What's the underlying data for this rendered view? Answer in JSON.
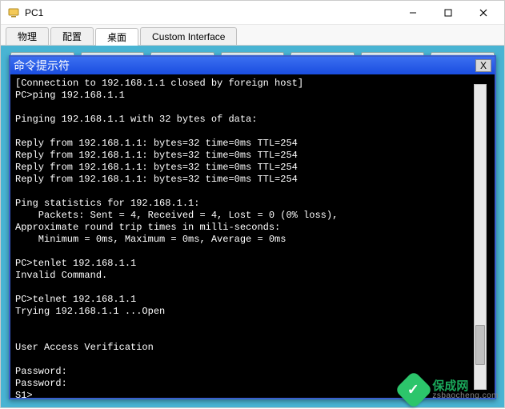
{
  "window": {
    "title": "PC1",
    "icon_name": "pc-icon"
  },
  "tabs": [
    {
      "label": "物理",
      "active": false
    },
    {
      "label": "配置",
      "active": false
    },
    {
      "label": "桌面",
      "active": true
    },
    {
      "label": "Custom Interface",
      "active": false
    }
  ],
  "terminal": {
    "title": "命令提示符",
    "close_label": "X",
    "lines": [
      "[Connection to 192.168.1.1 closed by foreign host]",
      "PC>ping 192.168.1.1",
      "",
      "Pinging 192.168.1.1 with 32 bytes of data:",
      "",
      "Reply from 192.168.1.1: bytes=32 time=0ms TTL=254",
      "Reply from 192.168.1.1: bytes=32 time=0ms TTL=254",
      "Reply from 192.168.1.1: bytes=32 time=0ms TTL=254",
      "Reply from 192.168.1.1: bytes=32 time=0ms TTL=254",
      "",
      "Ping statistics for 192.168.1.1:",
      "    Packets: Sent = 4, Received = 4, Lost = 0 (0% loss),",
      "Approximate round trip times in milli-seconds:",
      "    Minimum = 0ms, Maximum = 0ms, Average = 0ms",
      "",
      "PC>tenlet 192.168.1.1",
      "Invalid Command.",
      "",
      "PC>telnet 192.168.1.1",
      "Trying 192.168.1.1 ...Open",
      "",
      "",
      "User Access Verification",
      "",
      "Password: ",
      "Password: ",
      "S1>"
    ]
  },
  "watermark": {
    "brand_cn": "保成网",
    "url": "zsbaocheng.com",
    "badge_glyph": "✓"
  }
}
